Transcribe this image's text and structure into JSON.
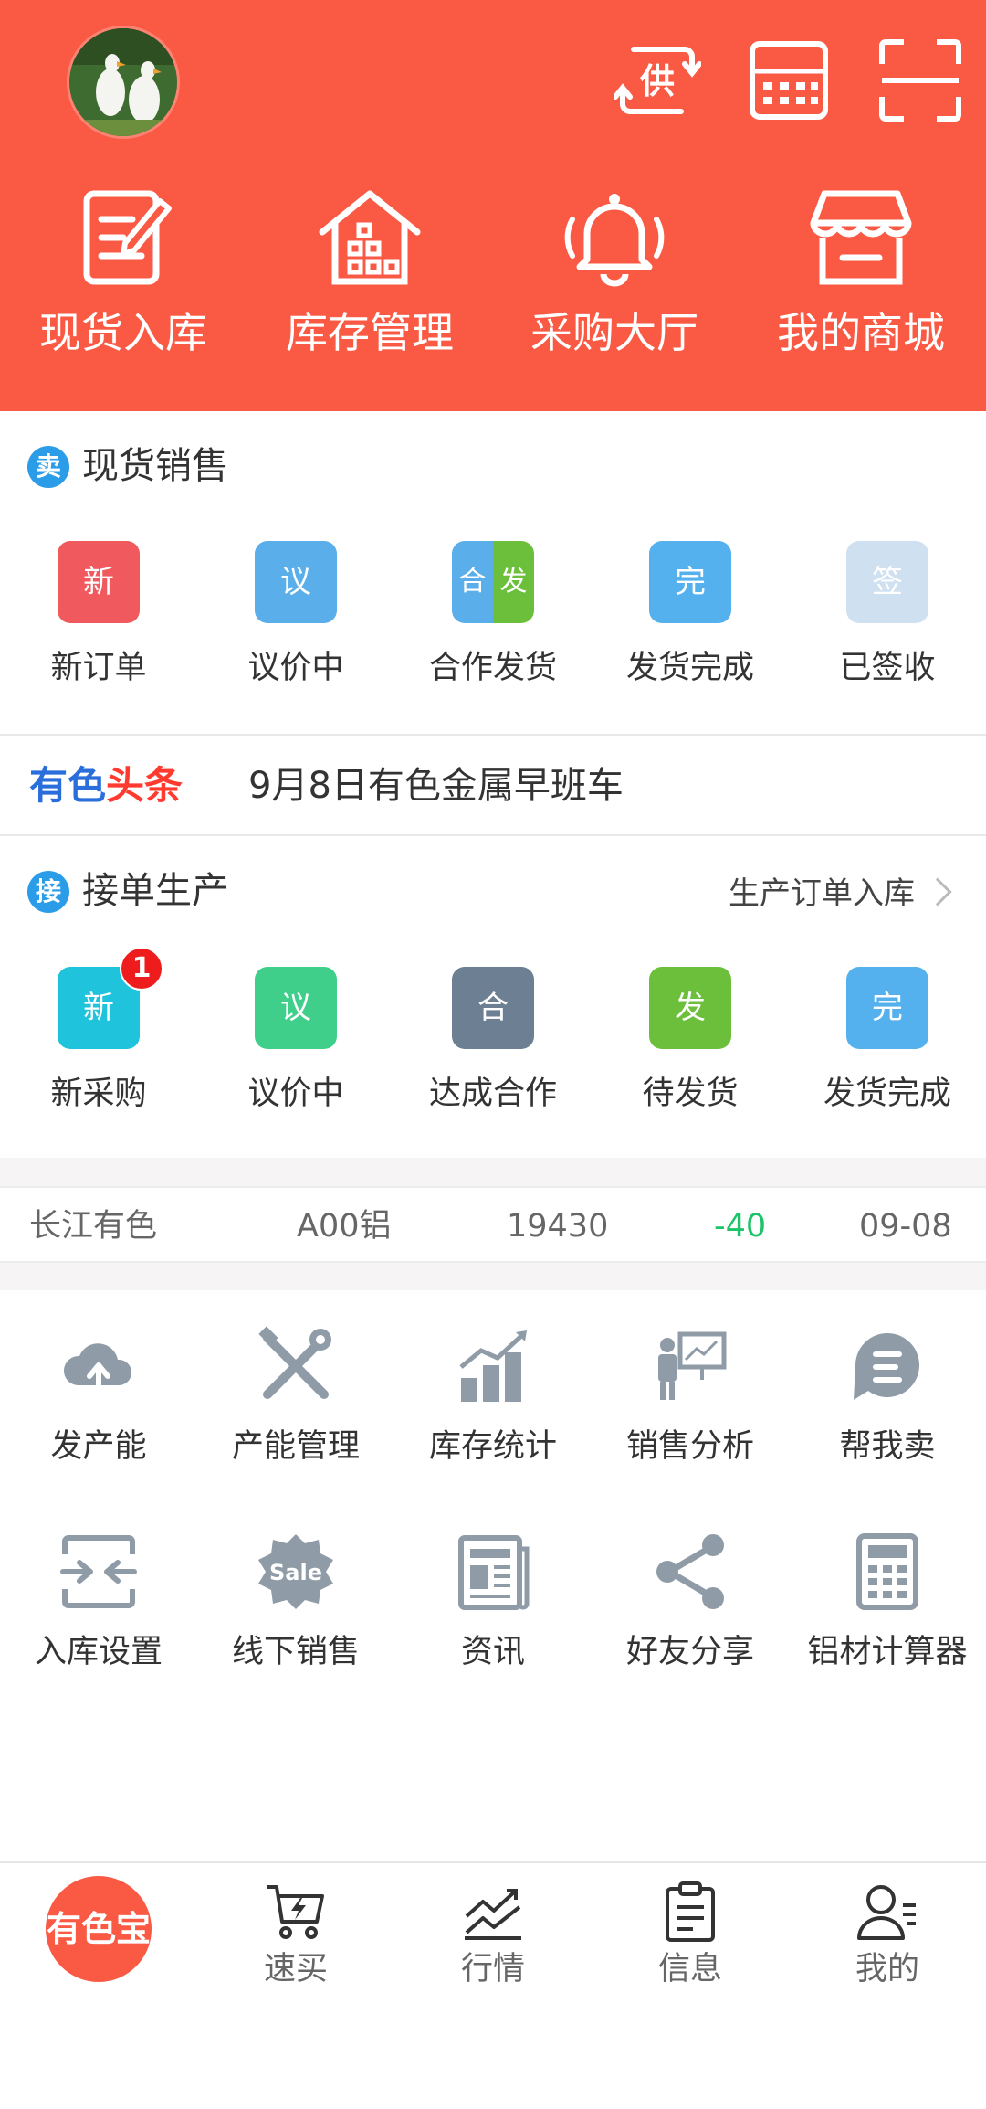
{
  "colors": {
    "brand_red": "#fa5a44",
    "badge_blue": "#2b9de8",
    "up_green": "#1ec46a",
    "icon_grey": "#8f9ba6"
  },
  "header": {
    "icons": [
      "supply-swap-icon",
      "calculator-icon",
      "scan-icon"
    ],
    "supply_glyph": "供",
    "quick_actions": [
      {
        "label": "现货入库",
        "icon": "stock-entry-icon"
      },
      {
        "label": "库存管理",
        "icon": "warehouse-icon"
      },
      {
        "label": "采购大厅",
        "icon": "bell-icon"
      },
      {
        "label": "我的商城",
        "icon": "shop-icon"
      }
    ]
  },
  "spot_sales": {
    "badge": "卖",
    "title": "现货销售",
    "items": [
      {
        "label": "新订单",
        "glyph": "新",
        "color": "#f05a5f"
      },
      {
        "label": "议价中",
        "glyph": "议",
        "color": "#5aaeea"
      },
      {
        "label": "合作发货",
        "glyph_left": "合",
        "glyph_right": "发",
        "color_left": "#5aaeea",
        "color_right": "#6cbf3b"
      },
      {
        "label": "发货完成",
        "glyph": "完",
        "color": "#55b0ee"
      },
      {
        "label": "已签收",
        "glyph": "签",
        "color": "#cfe0f0"
      }
    ]
  },
  "headline": {
    "brand_a": "有色",
    "brand_b": "头条",
    "text": "9月8日有色金属早班车"
  },
  "production": {
    "badge": "接",
    "title": "接单生产",
    "link": "生产订单入库",
    "items": [
      {
        "label": "新采购",
        "glyph": "新",
        "color": "#1fc3dc",
        "badge": "1"
      },
      {
        "label": "议价中",
        "glyph": "议",
        "color": "#3fcf8a"
      },
      {
        "label": "达成合作",
        "glyph": "合",
        "color": "#6c7f93"
      },
      {
        "label": "待发货",
        "glyph": "发",
        "color": "#6cbf3b"
      },
      {
        "label": "发货完成",
        "glyph": "完",
        "color": "#55b0ee"
      }
    ]
  },
  "ticker": {
    "market": "长江有色",
    "product": "A00铝",
    "price": "19430",
    "change": "-40",
    "date": "09-08"
  },
  "tools": [
    {
      "label": "发产能",
      "icon": "cloud-upload-icon"
    },
    {
      "label": "产能管理",
      "icon": "tools-icon"
    },
    {
      "label": "库存统计",
      "icon": "bar-chart-icon"
    },
    {
      "label": "销售分析",
      "icon": "presentation-icon"
    },
    {
      "label": "帮我卖",
      "icon": "help-sell-icon"
    },
    {
      "label": "入库设置",
      "icon": "inbound-settings-icon"
    },
    {
      "label": "线下销售",
      "icon": "sale-badge-icon",
      "glyph": "Sale"
    },
    {
      "label": "资讯",
      "icon": "newspaper-icon"
    },
    {
      "label": "好友分享",
      "icon": "share-icon"
    },
    {
      "label": "铝材计算器",
      "icon": "calculator-icon"
    }
  ],
  "tabbar": {
    "home": "有色宝",
    "tabs": [
      {
        "label": "速买",
        "icon": "quick-buy-cart-icon"
      },
      {
        "label": "行情",
        "icon": "market-trend-icon"
      },
      {
        "label": "信息",
        "icon": "clipboard-icon"
      },
      {
        "label": "我的",
        "icon": "profile-icon"
      }
    ]
  }
}
